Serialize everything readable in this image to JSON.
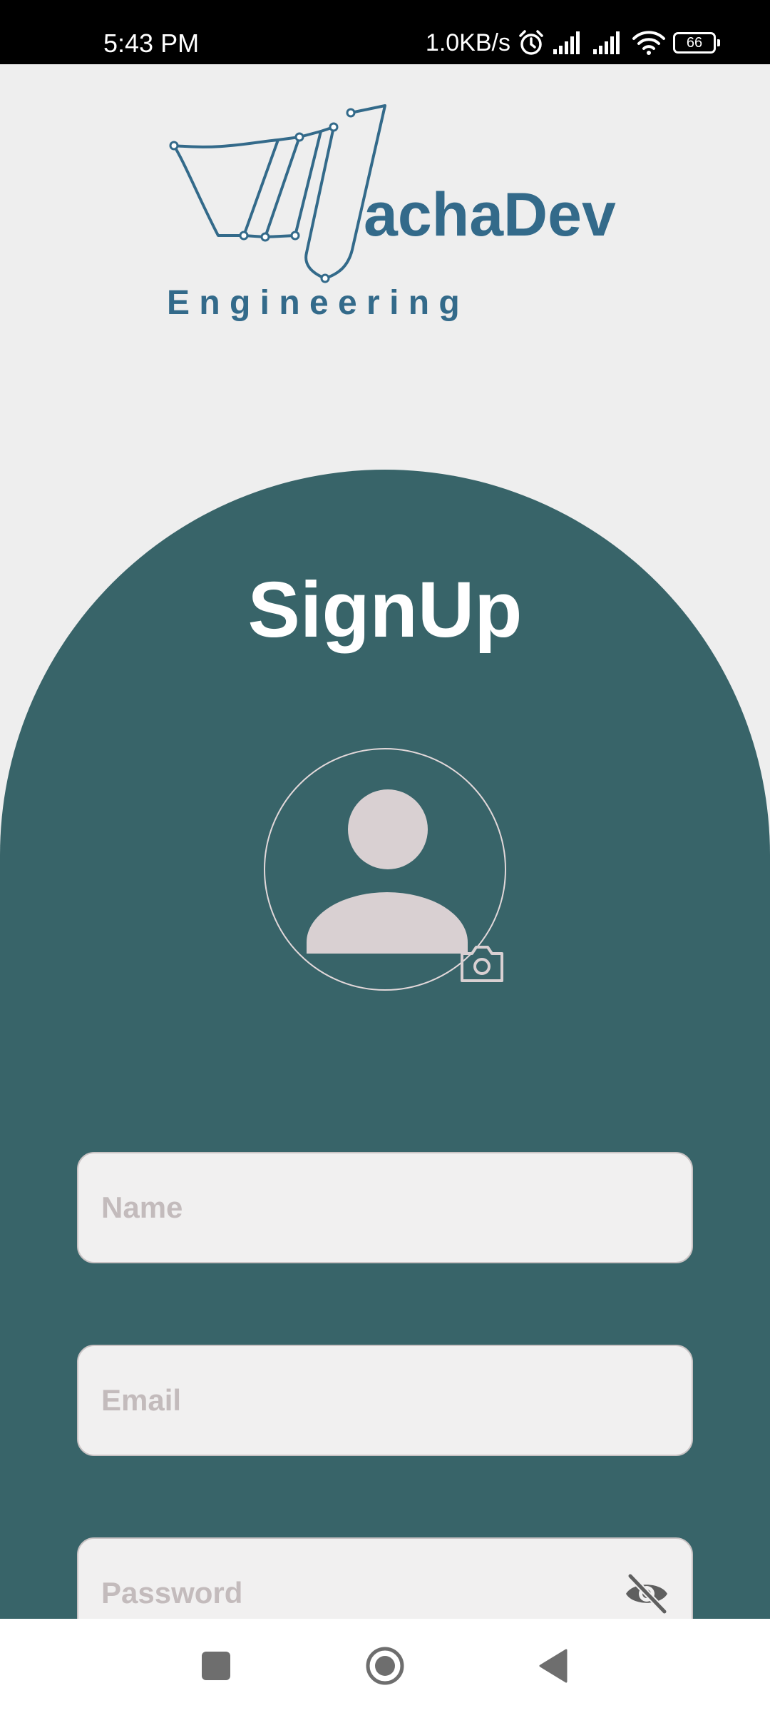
{
  "status_bar": {
    "time": "5:43 PM",
    "net_speed": "1.0KB/s",
    "battery": "66",
    "icons": [
      "alarm-icon",
      "signal-icon",
      "signal-icon",
      "wifi-icon",
      "battery-icon"
    ]
  },
  "logo": {
    "brand": "achaDev",
    "subtitle": "E n g i n e e r i n g",
    "color": "#336a8a"
  },
  "form": {
    "title": "SignUp",
    "name_placeholder": "Name",
    "email_placeholder": "Email",
    "password_placeholder": "Password",
    "avatar_icon": "person-icon",
    "camera_icon": "camera-icon",
    "password_toggle_icon": "eye-off-icon"
  },
  "colors": {
    "panel": "#386469",
    "background": "#eeeeee",
    "field": "#f1f0f0",
    "placeholder": "#c3bbbc"
  },
  "nav_bar": {
    "buttons": [
      "recent-apps-icon",
      "home-icon",
      "back-icon"
    ]
  }
}
